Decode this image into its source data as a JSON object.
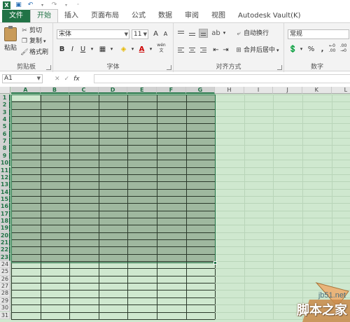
{
  "tabs": [
    "文件",
    "开始",
    "插入",
    "页面布局",
    "公式",
    "数据",
    "审阅",
    "视图",
    "Autodesk Vault(K)"
  ],
  "ribbon": {
    "clipboard": {
      "paste": "粘贴",
      "cut": "剪切",
      "copy": "复制",
      "format_painter": "格式刷",
      "label": "剪贴板"
    },
    "font": {
      "name": "宋体",
      "size": "11",
      "grow": "A",
      "shrink": "A",
      "bold": "B",
      "italic": "I",
      "underline": "U",
      "wen": "wén",
      "label": "字体"
    },
    "alignment": {
      "wrap": "自动换行",
      "merge": "合并后居中",
      "label": "对齐方式"
    },
    "number": {
      "format": "常规",
      "percent": "%",
      "comma": ",",
      "label": "数字"
    }
  },
  "formula_bar": {
    "name_box": "A1",
    "fx": "fx"
  },
  "columns": [
    "A",
    "B",
    "C",
    "D",
    "E",
    "F",
    "G",
    "H",
    "I",
    "J",
    "K",
    "L"
  ],
  "rows": [
    "1",
    "2",
    "3",
    "4",
    "5",
    "6",
    "7",
    "8",
    "9",
    "10",
    "11",
    "12",
    "13",
    "14",
    "15",
    "16",
    "17",
    "18",
    "19",
    "20",
    "21",
    "22",
    "23",
    "24",
    "25",
    "26",
    "27",
    "28",
    "29",
    "30",
    "31"
  ],
  "watermark": {
    "site": "jb51.net",
    "brand": "脚本之家"
  },
  "colors": {
    "excel_green": "#217346",
    "sheet_bg": "#cfe8cf",
    "selection": "#9fb89f"
  }
}
